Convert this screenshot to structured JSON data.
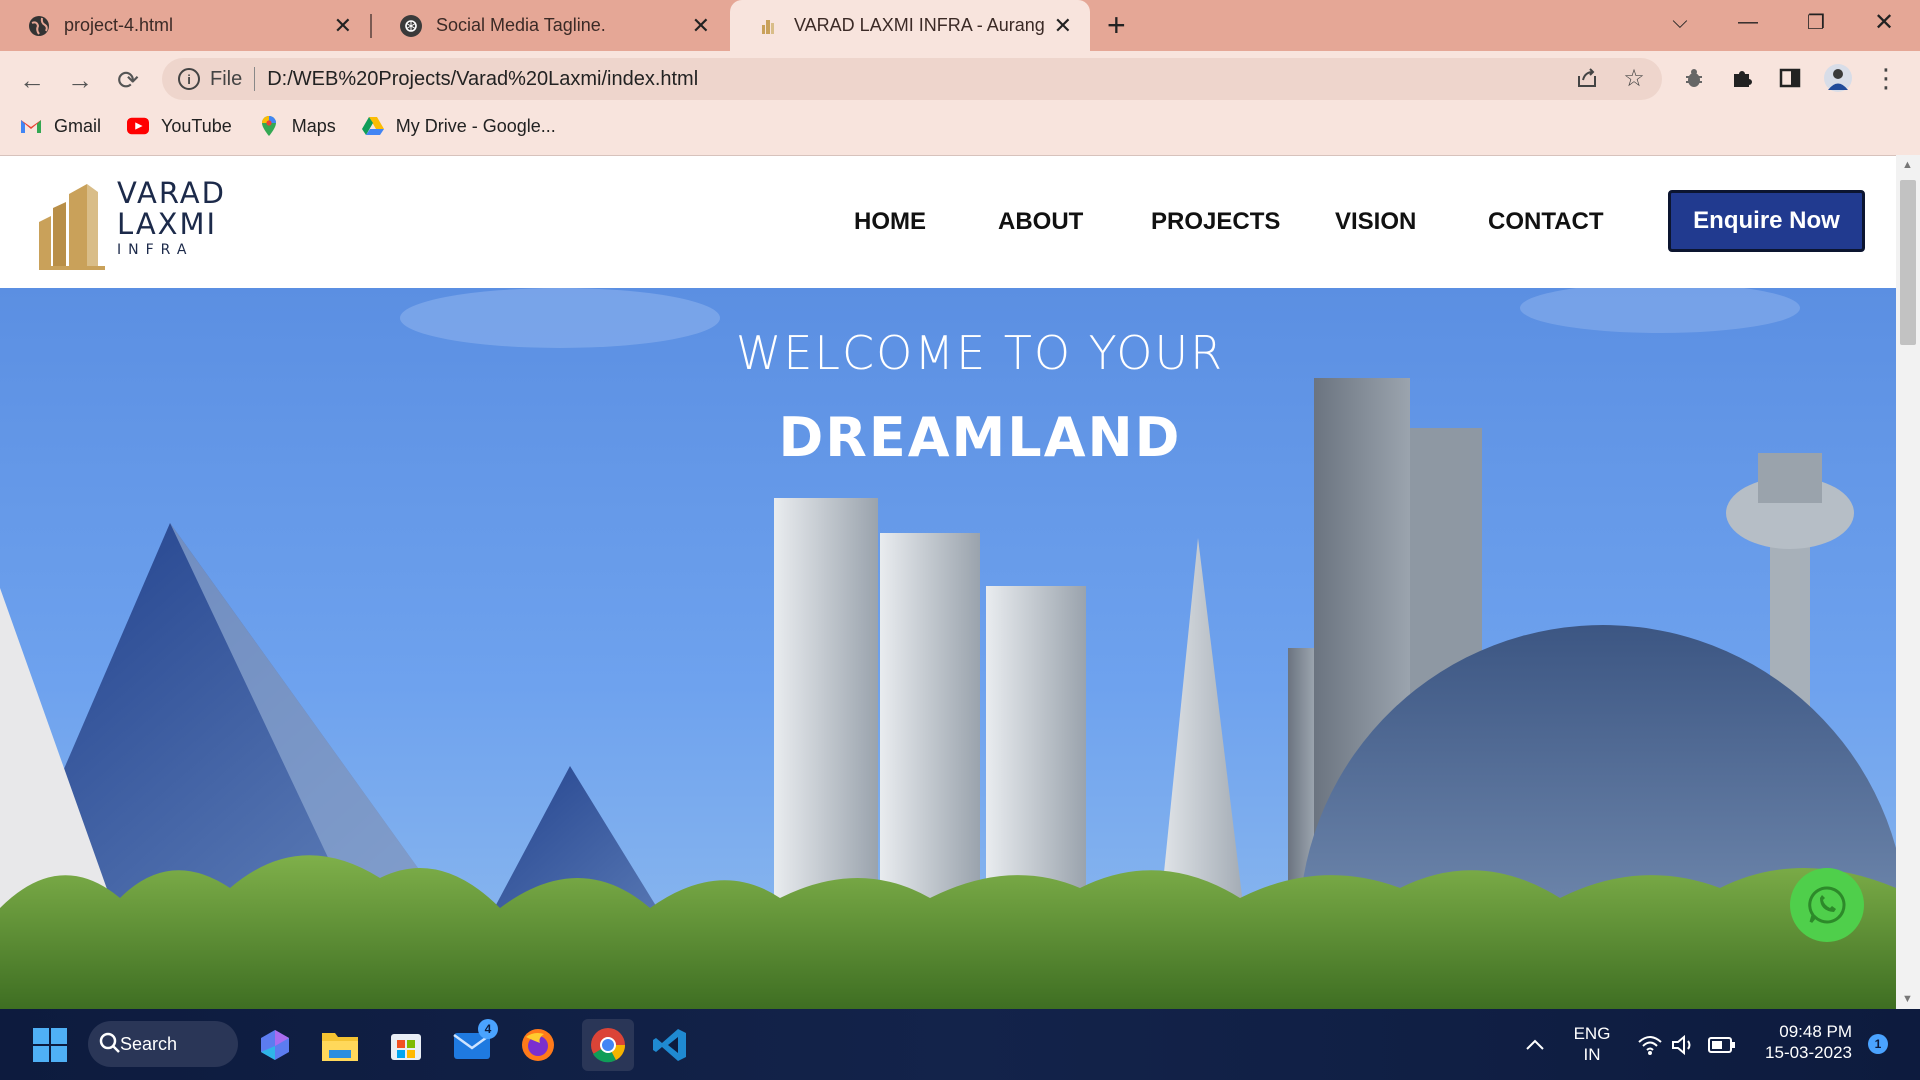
{
  "browser": {
    "tabs": [
      {
        "label": "project-4.html",
        "icon": "globe-icon"
      },
      {
        "label": "Social Media Tagline.",
        "icon": "chatgpt-icon"
      },
      {
        "label": "VARAD LAXMI INFRA - Aurangab",
        "icon": "site-favicon",
        "active": true
      }
    ],
    "address": {
      "scheme_label": "File",
      "url": "D:/WEB%20Projects/Varad%20Laxmi/index.html"
    },
    "bookmarks": [
      {
        "label": "Gmail",
        "icon": "gmail-icon"
      },
      {
        "label": "YouTube",
        "icon": "youtube-icon"
      },
      {
        "label": "Maps",
        "icon": "maps-icon"
      },
      {
        "label": "My Drive - Google...",
        "icon": "drive-icon"
      }
    ]
  },
  "site": {
    "logo": {
      "line1": "VARAD",
      "line2": "LAXMI",
      "line3": "INFRA"
    },
    "nav": [
      "HOME",
      "ABOUT",
      "PROJECTS",
      "VISION",
      "CONTACT"
    ],
    "cta": "Enquire Now",
    "hero": {
      "welcome": "WELCOME TO YOUR",
      "headline": "DREAMLAND"
    },
    "colors": {
      "cta_bg": "#213a8f",
      "whatsapp": "#4fcf4b",
      "logo_gold": "#c9a15a",
      "logo_text": "#1c2a4a"
    }
  },
  "taskbar": {
    "search_label": "Search",
    "mail_badge": "4",
    "lang_line1": "ENG",
    "lang_line2": "IN",
    "time": "09:48 PM",
    "date": "15-03-2023",
    "notification_count": "1"
  }
}
